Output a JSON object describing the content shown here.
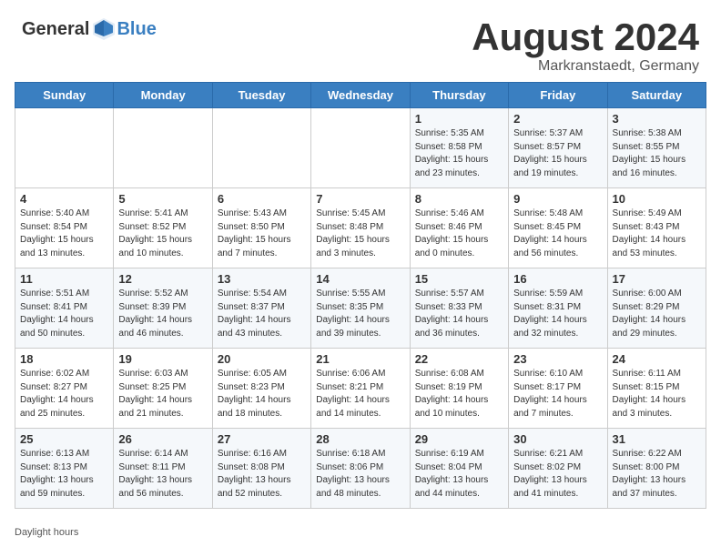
{
  "header": {
    "logo_general": "General",
    "logo_blue": "Blue",
    "title": "August 2024",
    "subtitle": "Markranstaedt, Germany"
  },
  "weekdays": [
    "Sunday",
    "Monday",
    "Tuesday",
    "Wednesday",
    "Thursday",
    "Friday",
    "Saturday"
  ],
  "weeks": [
    [
      {
        "day": "",
        "info": ""
      },
      {
        "day": "",
        "info": ""
      },
      {
        "day": "",
        "info": ""
      },
      {
        "day": "",
        "info": ""
      },
      {
        "day": "1",
        "info": "Sunrise: 5:35 AM\nSunset: 8:58 PM\nDaylight: 15 hours\nand 23 minutes."
      },
      {
        "day": "2",
        "info": "Sunrise: 5:37 AM\nSunset: 8:57 PM\nDaylight: 15 hours\nand 19 minutes."
      },
      {
        "day": "3",
        "info": "Sunrise: 5:38 AM\nSunset: 8:55 PM\nDaylight: 15 hours\nand 16 minutes."
      }
    ],
    [
      {
        "day": "4",
        "info": "Sunrise: 5:40 AM\nSunset: 8:54 PM\nDaylight: 15 hours\nand 13 minutes."
      },
      {
        "day": "5",
        "info": "Sunrise: 5:41 AM\nSunset: 8:52 PM\nDaylight: 15 hours\nand 10 minutes."
      },
      {
        "day": "6",
        "info": "Sunrise: 5:43 AM\nSunset: 8:50 PM\nDaylight: 15 hours\nand 7 minutes."
      },
      {
        "day": "7",
        "info": "Sunrise: 5:45 AM\nSunset: 8:48 PM\nDaylight: 15 hours\nand 3 minutes."
      },
      {
        "day": "8",
        "info": "Sunrise: 5:46 AM\nSunset: 8:46 PM\nDaylight: 15 hours\nand 0 minutes."
      },
      {
        "day": "9",
        "info": "Sunrise: 5:48 AM\nSunset: 8:45 PM\nDaylight: 14 hours\nand 56 minutes."
      },
      {
        "day": "10",
        "info": "Sunrise: 5:49 AM\nSunset: 8:43 PM\nDaylight: 14 hours\nand 53 minutes."
      }
    ],
    [
      {
        "day": "11",
        "info": "Sunrise: 5:51 AM\nSunset: 8:41 PM\nDaylight: 14 hours\nand 50 minutes."
      },
      {
        "day": "12",
        "info": "Sunrise: 5:52 AM\nSunset: 8:39 PM\nDaylight: 14 hours\nand 46 minutes."
      },
      {
        "day": "13",
        "info": "Sunrise: 5:54 AM\nSunset: 8:37 PM\nDaylight: 14 hours\nand 43 minutes."
      },
      {
        "day": "14",
        "info": "Sunrise: 5:55 AM\nSunset: 8:35 PM\nDaylight: 14 hours\nand 39 minutes."
      },
      {
        "day": "15",
        "info": "Sunrise: 5:57 AM\nSunset: 8:33 PM\nDaylight: 14 hours\nand 36 minutes."
      },
      {
        "day": "16",
        "info": "Sunrise: 5:59 AM\nSunset: 8:31 PM\nDaylight: 14 hours\nand 32 minutes."
      },
      {
        "day": "17",
        "info": "Sunrise: 6:00 AM\nSunset: 8:29 PM\nDaylight: 14 hours\nand 29 minutes."
      }
    ],
    [
      {
        "day": "18",
        "info": "Sunrise: 6:02 AM\nSunset: 8:27 PM\nDaylight: 14 hours\nand 25 minutes."
      },
      {
        "day": "19",
        "info": "Sunrise: 6:03 AM\nSunset: 8:25 PM\nDaylight: 14 hours\nand 21 minutes."
      },
      {
        "day": "20",
        "info": "Sunrise: 6:05 AM\nSunset: 8:23 PM\nDaylight: 14 hours\nand 18 minutes."
      },
      {
        "day": "21",
        "info": "Sunrise: 6:06 AM\nSunset: 8:21 PM\nDaylight: 14 hours\nand 14 minutes."
      },
      {
        "day": "22",
        "info": "Sunrise: 6:08 AM\nSunset: 8:19 PM\nDaylight: 14 hours\nand 10 minutes."
      },
      {
        "day": "23",
        "info": "Sunrise: 6:10 AM\nSunset: 8:17 PM\nDaylight: 14 hours\nand 7 minutes."
      },
      {
        "day": "24",
        "info": "Sunrise: 6:11 AM\nSunset: 8:15 PM\nDaylight: 14 hours\nand 3 minutes."
      }
    ],
    [
      {
        "day": "25",
        "info": "Sunrise: 6:13 AM\nSunset: 8:13 PM\nDaylight: 13 hours\nand 59 minutes."
      },
      {
        "day": "26",
        "info": "Sunrise: 6:14 AM\nSunset: 8:11 PM\nDaylight: 13 hours\nand 56 minutes."
      },
      {
        "day": "27",
        "info": "Sunrise: 6:16 AM\nSunset: 8:08 PM\nDaylight: 13 hours\nand 52 minutes."
      },
      {
        "day": "28",
        "info": "Sunrise: 6:18 AM\nSunset: 8:06 PM\nDaylight: 13 hours\nand 48 minutes."
      },
      {
        "day": "29",
        "info": "Sunrise: 6:19 AM\nSunset: 8:04 PM\nDaylight: 13 hours\nand 44 minutes."
      },
      {
        "day": "30",
        "info": "Sunrise: 6:21 AM\nSunset: 8:02 PM\nDaylight: 13 hours\nand 41 minutes."
      },
      {
        "day": "31",
        "info": "Sunrise: 6:22 AM\nSunset: 8:00 PM\nDaylight: 13 hours\nand 37 minutes."
      }
    ]
  ],
  "footer": {
    "daylight_label": "Daylight hours"
  }
}
